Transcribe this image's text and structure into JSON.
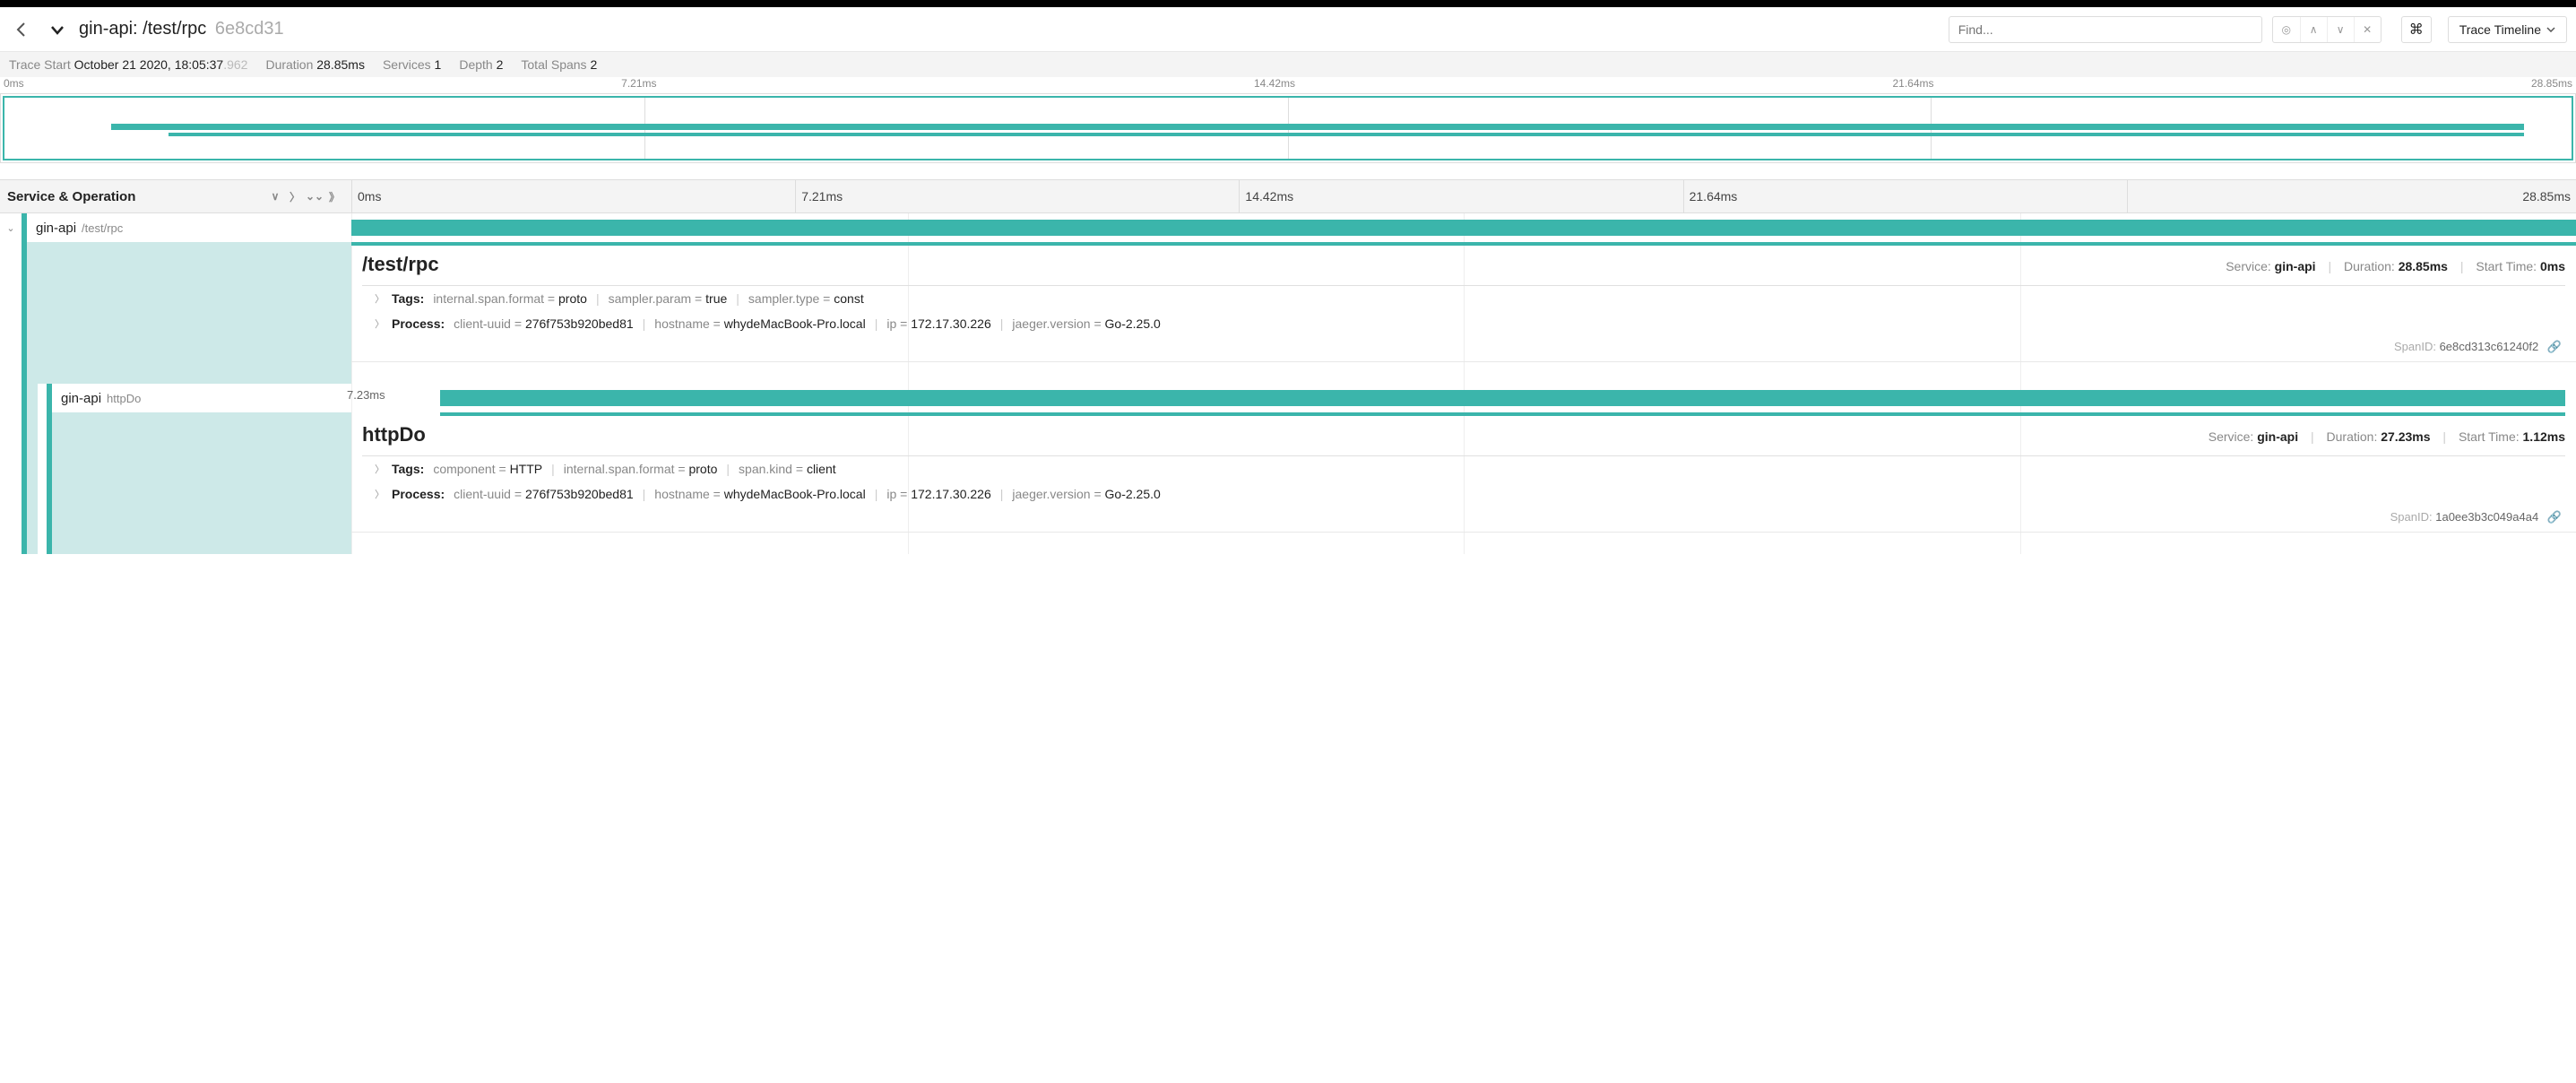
{
  "header": {
    "title_service": "gin-api:",
    "title_operation": "/test/rpc",
    "title_hash": "6e8cd31",
    "find_placeholder": "Find...",
    "trace_timeline_label": "Trace Timeline"
  },
  "stats": {
    "trace_start_label": "Trace Start",
    "trace_start_value": "October 21 2020, 18:05:37",
    "trace_start_ms": ".962",
    "duration_label": "Duration",
    "duration_value": "28.85ms",
    "services_label": "Services",
    "services_value": "1",
    "depth_label": "Depth",
    "depth_value": "2",
    "total_spans_label": "Total Spans",
    "total_spans_value": "2"
  },
  "minimap_ticks": [
    "0ms",
    "7.21ms",
    "14.42ms",
    "21.64ms",
    "28.85ms"
  ],
  "timeline": {
    "svc_op_label": "Service & Operation",
    "ticks": [
      "0ms",
      "7.21ms",
      "14.42ms",
      "21.64ms",
      "28.85ms"
    ]
  },
  "spans": [
    {
      "service": "gin-api",
      "operation": "/test/rpc",
      "tags": [
        {
          "k": "internal.span.format",
          "v": "proto"
        },
        {
          "k": "sampler.param",
          "v": "true"
        },
        {
          "k": "sampler.type",
          "v": "const"
        }
      ],
      "process": [
        {
          "k": "client-uuid",
          "v": "276f753b920bed81"
        },
        {
          "k": "hostname",
          "v": "whydeMacBook-Pro.local"
        },
        {
          "k": "ip",
          "v": "172.17.30.226"
        },
        {
          "k": "jaeger.version",
          "v": "Go-2.25.0"
        }
      ],
      "detail_service": "gin-api",
      "detail_duration": "28.85ms",
      "detail_start": "0ms",
      "span_id": "6e8cd313c61240f2"
    },
    {
      "service": "gin-api",
      "operation": "httpDo",
      "bar_label": "7.23ms",
      "tags": [
        {
          "k": "component",
          "v": "HTTP"
        },
        {
          "k": "internal.span.format",
          "v": "proto"
        },
        {
          "k": "span.kind",
          "v": "client"
        }
      ],
      "process": [
        {
          "k": "client-uuid",
          "v": "276f753b920bed81"
        },
        {
          "k": "hostname",
          "v": "whydeMacBook-Pro.local"
        },
        {
          "k": "ip",
          "v": "172.17.30.226"
        },
        {
          "k": "jaeger.version",
          "v": "Go-2.25.0"
        }
      ],
      "detail_service": "gin-api",
      "detail_duration": "27.23ms",
      "detail_start": "1.12ms",
      "span_id": "1a0ee3b3c049a4a4"
    }
  ],
  "labels": {
    "tags": "Tags:",
    "process": "Process:",
    "service": "Service:",
    "duration": "Duration:",
    "start_time": "Start Time:",
    "span_id": "SpanID:"
  }
}
